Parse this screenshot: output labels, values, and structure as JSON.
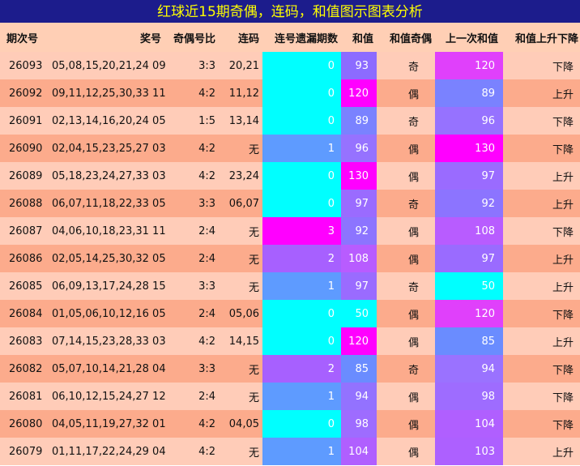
{
  "title": "红球近15期奇偶，连码，和值图示图表分析",
  "headers": [
    "期次号",
    "奖号",
    "奇偶号比",
    "连码",
    "连号遗漏期数",
    "和值",
    "和值奇偶",
    "上一次和值",
    "和值上升下降"
  ],
  "colors": {
    "miss": [
      "#00ffff",
      "#5e9bff",
      "#a760ff",
      "#ff00ff"
    ]
  },
  "rows": [
    {
      "period": "26093",
      "numbers": "05,08,15,20,21,24 09",
      "ratio": "3:3",
      "consec": "20,21",
      "miss": "0",
      "sum": "93",
      "sum_color": "#8c6bff",
      "parity": "奇",
      "prev": "120",
      "prev_color": "#e040fb",
      "trend": "下降"
    },
    {
      "period": "26092",
      "numbers": "09,11,12,25,30,33 11",
      "ratio": "4:2",
      "consec": "11,12",
      "miss": "0",
      "sum": "120",
      "sum_color": "#ff00ff",
      "parity": "偶",
      "prev": "89",
      "prev_color": "#7a82ff",
      "trend": "上升"
    },
    {
      "period": "26091",
      "numbers": "02,13,14,16,20,24 05",
      "ratio": "1:5",
      "consec": "13,14",
      "miss": "0",
      "sum": "89",
      "sum_color": "#7a82ff",
      "parity": "奇",
      "prev": "96",
      "prev_color": "#9672ff",
      "trend": "下降"
    },
    {
      "period": "26090",
      "numbers": "02,04,15,23,25,27 03",
      "ratio": "4:2",
      "consec": "无",
      "miss": "1",
      "sum": "96",
      "sum_color": "#9672ff",
      "parity": "偶",
      "prev": "130",
      "prev_color": "#ff00ff",
      "trend": "下降"
    },
    {
      "period": "26089",
      "numbers": "05,18,23,24,27,33 03",
      "ratio": "4:2",
      "consec": "23,24",
      "miss": "0",
      "sum": "130",
      "sum_color": "#ff00ff",
      "parity": "偶",
      "prev": "97",
      "prev_color": "#9a6bff",
      "trend": "上升"
    },
    {
      "period": "26088",
      "numbers": "06,07,11,18,22,33 05",
      "ratio": "3:3",
      "consec": "06,07",
      "miss": "0",
      "sum": "97",
      "sum_color": "#9a6bff",
      "parity": "奇",
      "prev": "92",
      "prev_color": "#8c74ff",
      "trend": "上升"
    },
    {
      "period": "26087",
      "numbers": "04,06,10,18,23,31 11",
      "ratio": "2:4",
      "consec": "无",
      "miss": "3",
      "sum": "92",
      "sum_color": "#8c74ff",
      "parity": "偶",
      "prev": "108",
      "prev_color": "#b85cff",
      "trend": "下降"
    },
    {
      "period": "26086",
      "numbers": "02,05,14,25,30,32 05",
      "ratio": "2:4",
      "consec": "无",
      "miss": "2",
      "sum": "108",
      "sum_color": "#b85cff",
      "parity": "偶",
      "prev": "97",
      "prev_color": "#9a6bff",
      "trend": "上升"
    },
    {
      "period": "26085",
      "numbers": "06,09,13,17,24,28 15",
      "ratio": "3:3",
      "consec": "无",
      "miss": "1",
      "sum": "97",
      "sum_color": "#9a6bff",
      "parity": "奇",
      "prev": "50",
      "prev_color": "#00ffff",
      "trend": "上升"
    },
    {
      "period": "26084",
      "numbers": "01,05,06,10,12,16 05",
      "ratio": "2:4",
      "consec": "05,06",
      "miss": "0",
      "sum": "50",
      "sum_color": "#00ffff",
      "parity": "偶",
      "prev": "120",
      "prev_color": "#e040fb",
      "trend": "下降"
    },
    {
      "period": "26083",
      "numbers": "07,14,15,23,28,33 03",
      "ratio": "4:2",
      "consec": "14,15",
      "miss": "0",
      "sum": "120",
      "sum_color": "#ff00ff",
      "parity": "偶",
      "prev": "85",
      "prev_color": "#6a8cff",
      "trend": "上升"
    },
    {
      "period": "26082",
      "numbers": "05,07,10,14,21,28 04",
      "ratio": "3:3",
      "consec": "无",
      "miss": "2",
      "sum": "85",
      "sum_color": "#6a8cff",
      "parity": "奇",
      "prev": "94",
      "prev_color": "#9a72ff",
      "trend": "下降"
    },
    {
      "period": "26081",
      "numbers": "06,10,12,15,24,27 12",
      "ratio": "2:4",
      "consec": "无",
      "miss": "1",
      "sum": "94",
      "sum_color": "#9372ff",
      "parity": "偶",
      "prev": "98",
      "prev_color": "#9e6cff",
      "trend": "下降"
    },
    {
      "period": "26080",
      "numbers": "04,05,11,19,27,32 01",
      "ratio": "4:2",
      "consec": "04,05",
      "miss": "0",
      "sum": "98",
      "sum_color": "#9e6cff",
      "parity": "偶",
      "prev": "104",
      "prev_color": "#b05fff",
      "trend": "下降"
    },
    {
      "period": "26079",
      "numbers": "01,11,17,22,24,29 04",
      "ratio": "4:2",
      "consec": "无",
      "miss": "1",
      "sum": "104",
      "sum_color": "#b05fff",
      "parity": "偶",
      "prev": "103",
      "prev_color": "#ad60ff",
      "trend": "上升"
    }
  ]
}
